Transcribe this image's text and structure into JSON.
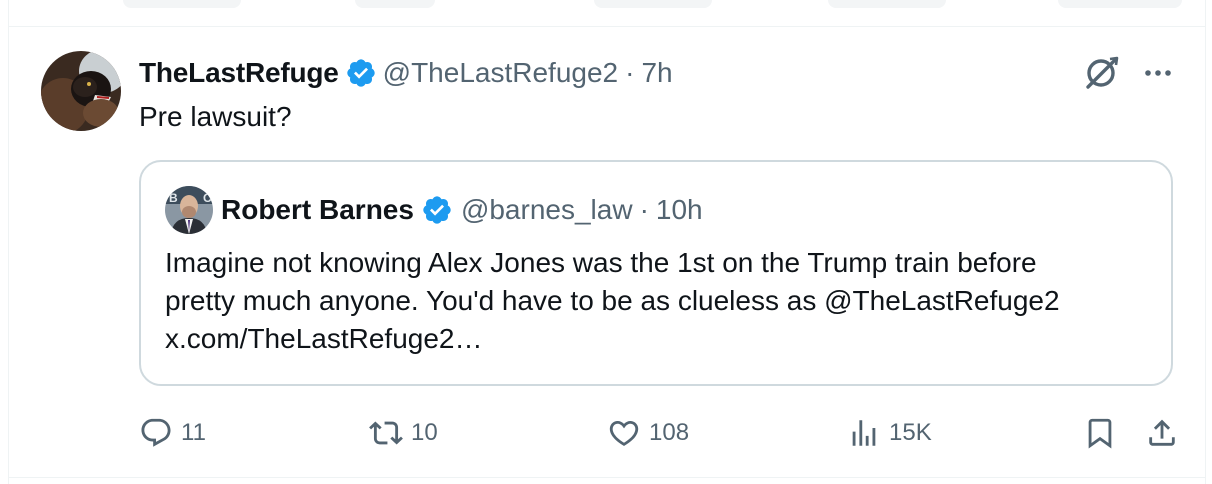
{
  "tweet": {
    "author_name": "TheLastRefuge",
    "author_handle": "@TheLastRefuge2",
    "separator": "·",
    "time": "7h",
    "text": "Pre lawsuit?",
    "verified_color": "#1d9bf0"
  },
  "quote": {
    "author_name": "Robert Barnes",
    "author_handle": "@barnes_law",
    "separator": "·",
    "time": "10h",
    "text_lines": [
      "Imagine not knowing Alex Jones was the 1st on the Trump train before",
      "pretty much anyone. You'd have to be as clueless as @TheLastRefuge2",
      "x.com/TheLastRefuge2…"
    ]
  },
  "actions": {
    "replies": "11",
    "reposts": "10",
    "likes": "108",
    "views": "15K"
  },
  "icons": {
    "grok": "grok-icon",
    "more": "more-icon",
    "reply": "reply-icon",
    "repost": "repost-icon",
    "like": "heart-icon",
    "views": "views-icon",
    "bookmark": "bookmark-icon",
    "share": "share-icon"
  }
}
